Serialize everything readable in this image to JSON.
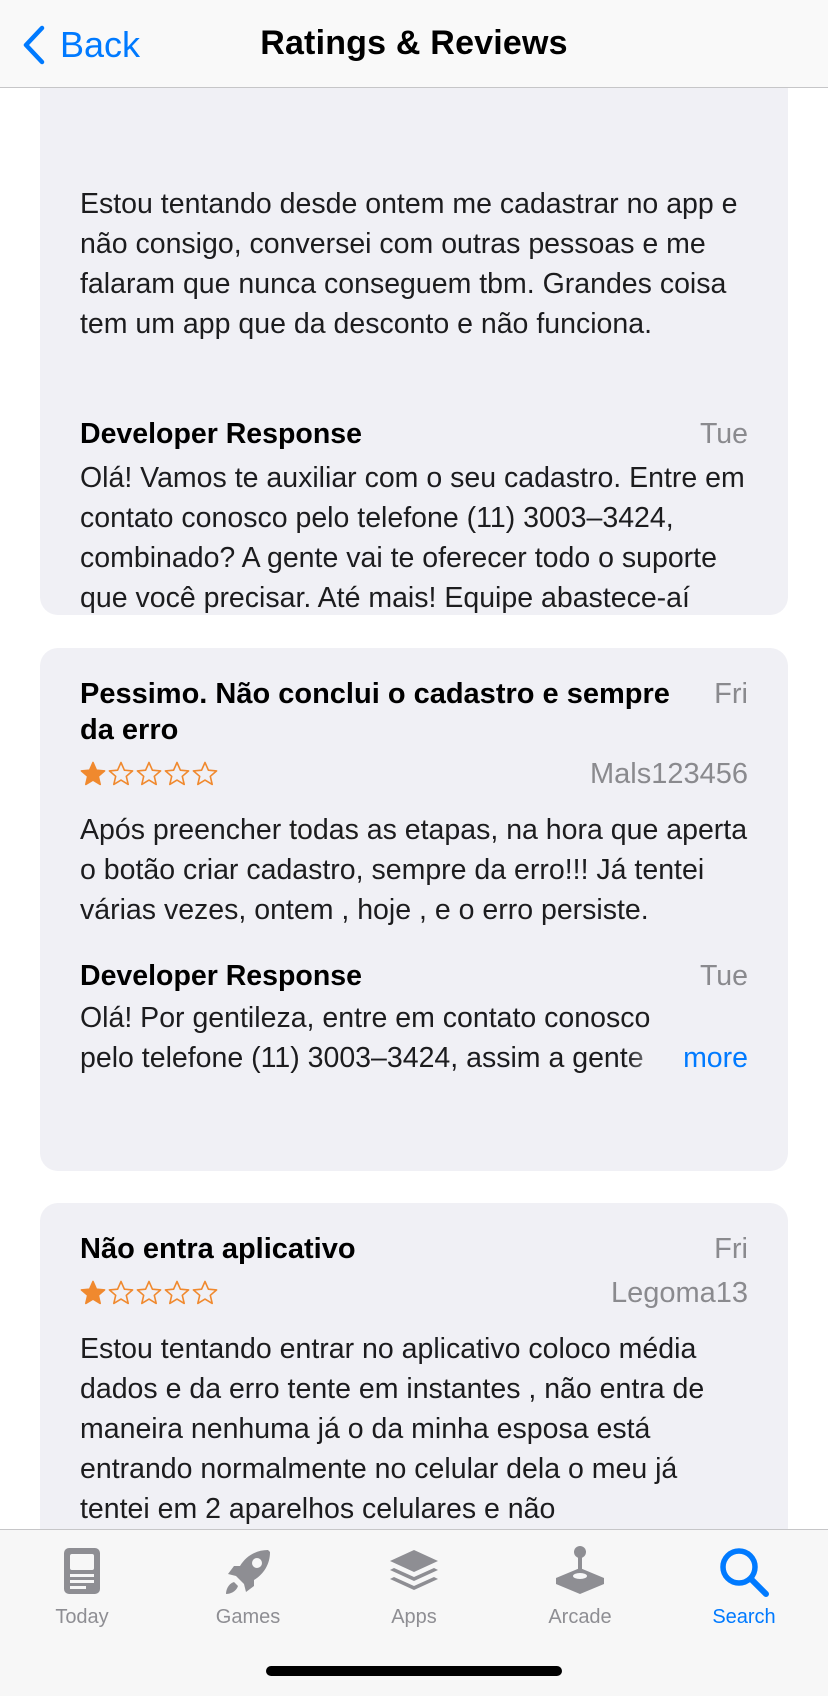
{
  "nav": {
    "back_label": "Back",
    "title": "Ratings & Reviews"
  },
  "reviews": [
    {
      "body": "Estou tentando desde ontem me cadastrar no app e não consigo, conversei com outras pessoas e me falaram que nunca conseguem tbm. Grandes coisa tem um app que da desconto e não funciona.",
      "developer_response": {
        "title": "Developer Response",
        "date": "Tue",
        "text": "Olá! Vamos te auxiliar com o seu cadastro. Entre em contato conosco pelo telefone (11) 3003–3424, combinado? A gente vai te oferecer todo o suporte que você precisar. Até mais!  Equipe abastece-aí"
      }
    },
    {
      "title": "Pessimo. Não conclui o cadastro e sempre da erro",
      "date": "Fri",
      "rating": 1,
      "max_rating": 5,
      "author": "Mals123456",
      "body": "Após preencher todas as etapas, na hora que aperta o botão criar cadastro, sempre da erro!!! Já tentei várias vezes, ontem , hoje , e o erro persiste.",
      "developer_response": {
        "title": "Developer Response",
        "date": "Tue",
        "line1": "Olá! Por gentileza, entre em contato conosco",
        "line2": "pelo telefone (11) 3003–3424, assim a gente",
        "more_label": "more"
      }
    },
    {
      "title": "Não entra aplicativo",
      "date": "Fri",
      "rating": 1,
      "max_rating": 5,
      "author": "Legoma13",
      "body": "Estou tentando entrar no aplicativo coloco média dados e da erro tente em instantes , não entra de maneira nenhuma já o da minha esposa está entrando normalmente no celular dela o meu já tentei em 2 aparelhos celulares e não"
    }
  ],
  "tabs": [
    {
      "label": "Today",
      "icon": "today-icon",
      "active": false
    },
    {
      "label": "Games",
      "icon": "rocket-icon",
      "active": false
    },
    {
      "label": "Apps",
      "icon": "apps-stack-icon",
      "active": false
    },
    {
      "label": "Arcade",
      "icon": "joystick-icon",
      "active": false
    },
    {
      "label": "Search",
      "icon": "search-icon",
      "active": true
    }
  ],
  "colors": {
    "accent": "#007aff",
    "star": "#f0892e",
    "card_bg": "#f0f0f5",
    "secondary_text": "#8a8a8e",
    "tab_inactive": "#8e8e93"
  }
}
